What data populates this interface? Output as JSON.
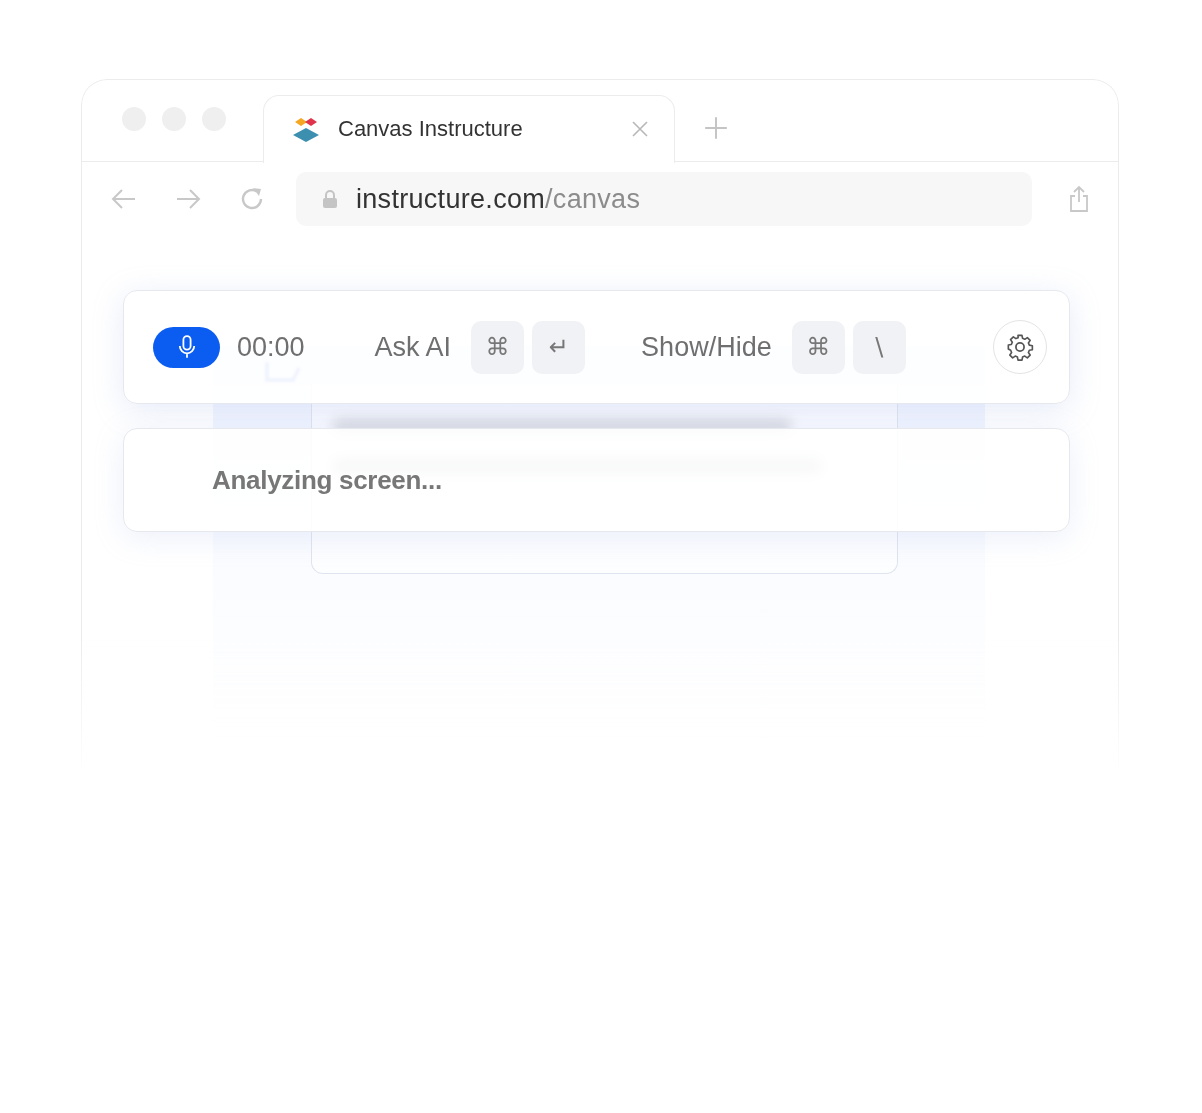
{
  "browser": {
    "tab": {
      "title": "Canvas Instructure"
    },
    "address": {
      "domain": "instructure.com",
      "path": "/canvas"
    }
  },
  "toolbar": {
    "timer": "00:00",
    "shortcuts": [
      {
        "label": "Ask AI",
        "keys": [
          "⌘",
          "↵"
        ]
      },
      {
        "label": "Show/Hide",
        "keys": [
          "⌘",
          "\\"
        ]
      }
    ]
  },
  "status": {
    "text": "Analyzing screen..."
  }
}
